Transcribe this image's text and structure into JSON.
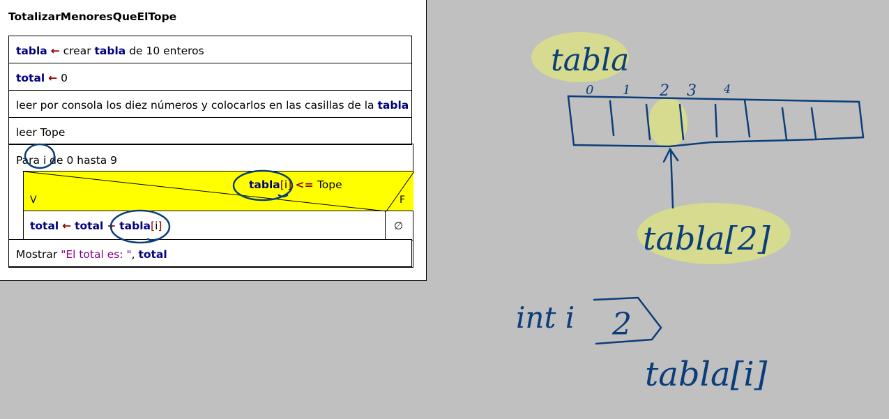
{
  "diagram": {
    "title": "TotalizarMenoresQueElTope",
    "row1": {
      "kw1": "tabla",
      "arrow": "←",
      "t1": " crear ",
      "kw2": "tabla",
      "t2": " de 10 enteros"
    },
    "row2": {
      "kw1": "total",
      "arrow": "←",
      "t1": " 0"
    },
    "row3": {
      "t1": "leer por consola los diez números y colocarlos en las casillas de la ",
      "kw1": "tabla"
    },
    "row4": {
      "t1": "leer Tope"
    },
    "loop": {
      "label": "Para i de 0 hasta 9"
    },
    "condition": {
      "kw1": "tabla",
      "lb": "[",
      "var": "i",
      "rb": "]",
      "op": " <= ",
      "t1": "Tope",
      "true_label": "V",
      "false_label": "F"
    },
    "true_branch": {
      "kw1": "total",
      "arrow": "←",
      "kw2": "total",
      "plus": "+",
      "kw3": "tabla",
      "lb": "[",
      "var": "i",
      "rb": "]"
    },
    "false_branch": {
      "symbol": "∅"
    },
    "output": {
      "t1": "Mostrar ",
      "str": "\"El total es: \"",
      "comma": ", ",
      "kw1": "total"
    }
  },
  "annotations": {
    "ink_color": "#0a3d7a",
    "highlight_color": "#d7db8f",
    "label_tabla": "tabla",
    "indices": [
      "0",
      "1",
      "2",
      "3",
      "4"
    ],
    "label_tabla_index": "tabla[2]",
    "int_label": "int i",
    "int_value": "2",
    "label_tabla_i": "tabla[i]"
  }
}
